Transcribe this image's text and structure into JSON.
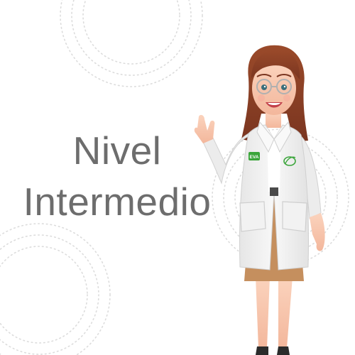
{
  "title": {
    "line1": "Nivel",
    "line2": "Intermedio"
  },
  "character": {
    "badge_text": "EVA"
  },
  "colors": {
    "title_text": "#6d6d6d",
    "dotted_circles": "#d9d9d9",
    "badge_green": "#3aa53a",
    "hair": "#8a3f24",
    "skirt": "#c58f5e",
    "coat": "#f4f4f4"
  },
  "icons": {
    "coat_logo": "green-leaf-logo",
    "glasses": "glasses"
  }
}
